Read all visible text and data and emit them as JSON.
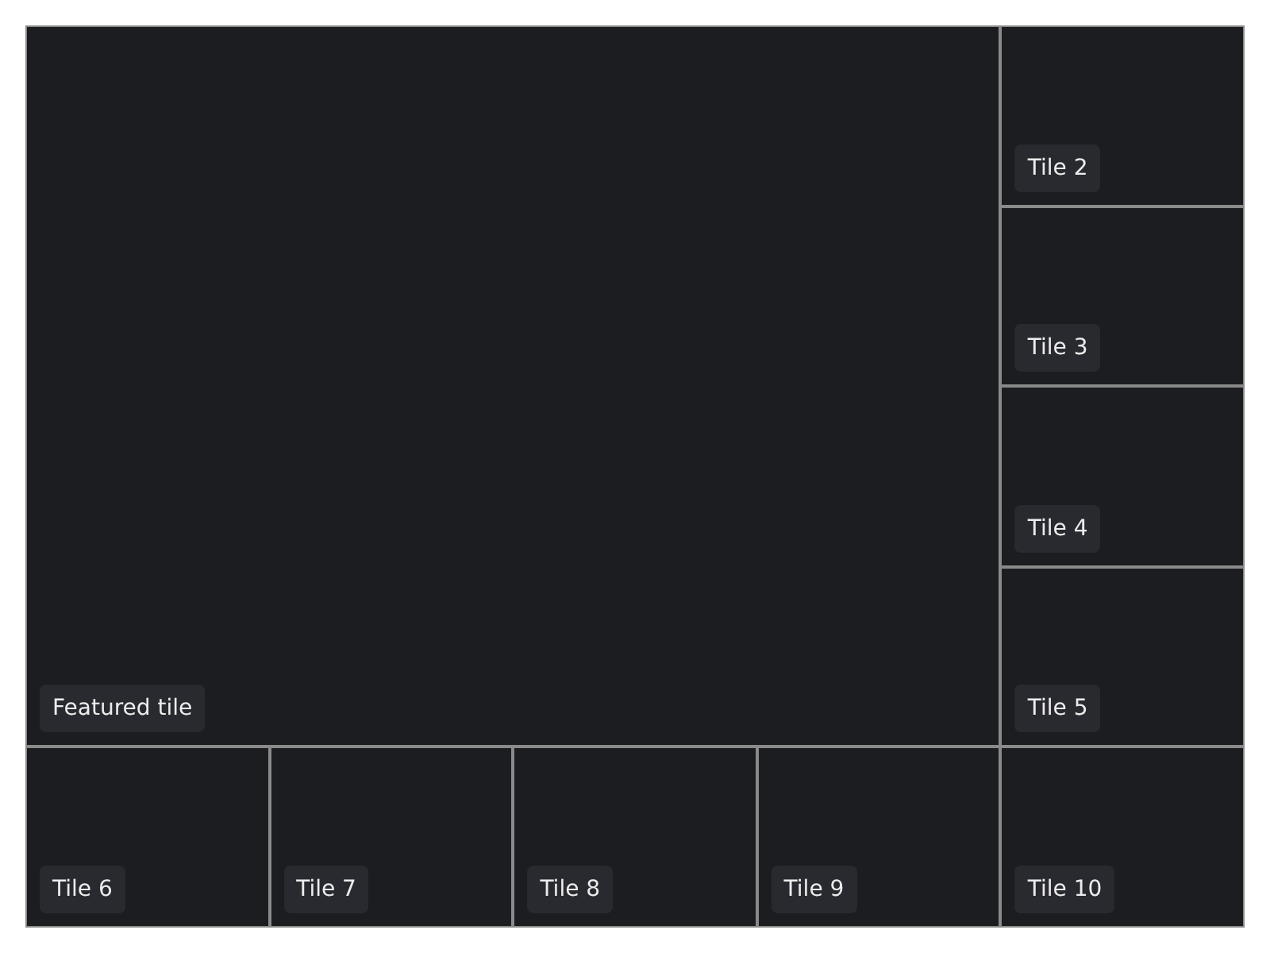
{
  "tiles": [
    {
      "kind": "featured",
      "label": "Featured tile"
    },
    {
      "kind": "standard",
      "label": "Tile 2"
    },
    {
      "kind": "standard",
      "label": "Tile 3"
    },
    {
      "kind": "standard",
      "label": "Tile 4"
    },
    {
      "kind": "standard",
      "label": "Tile 5"
    },
    {
      "kind": "standard",
      "label": "Tile 6"
    },
    {
      "kind": "standard",
      "label": "Tile 7"
    },
    {
      "kind": "standard",
      "label": "Tile 8"
    },
    {
      "kind": "standard",
      "label": "Tile 9"
    },
    {
      "kind": "standard",
      "label": "Tile 10"
    }
  ]
}
